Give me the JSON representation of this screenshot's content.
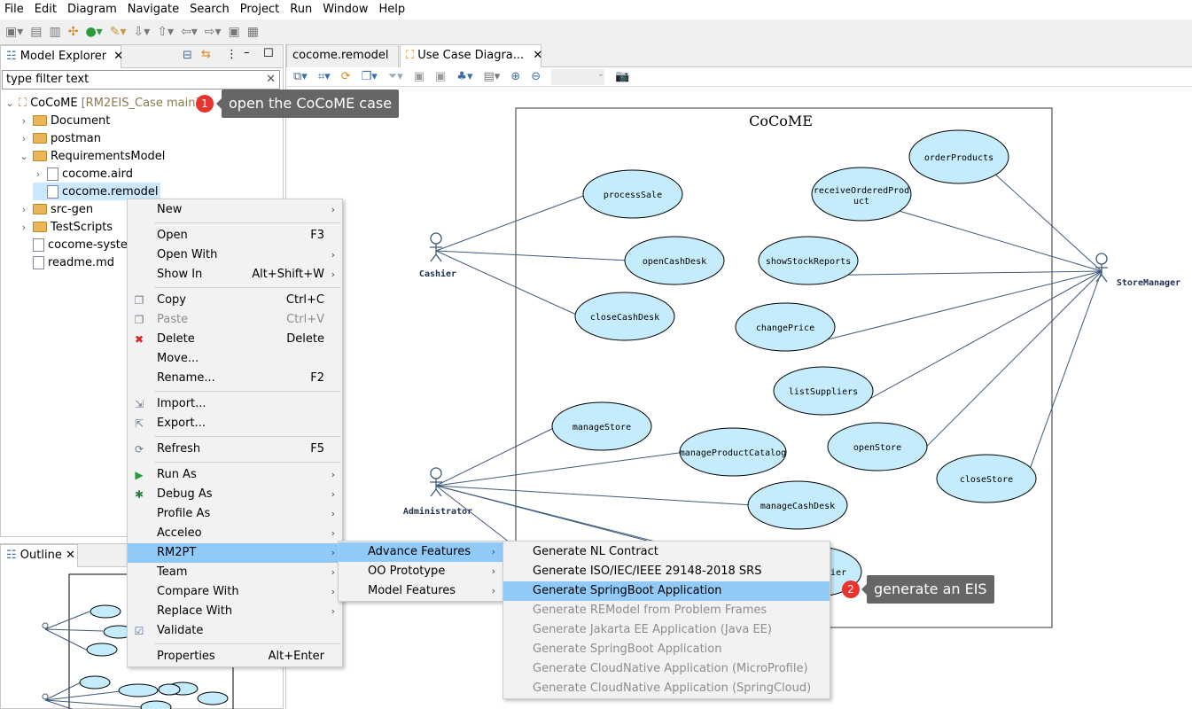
{
  "menubar": [
    "File",
    "Edit",
    "Diagram",
    "Navigate",
    "Search",
    "Project",
    "Run",
    "Window",
    "Help"
  ],
  "explorer": {
    "title": "Model Explorer",
    "filter_placeholder": "type filter text",
    "root": {
      "label": "CoCoME",
      "decoration": "[RM2EIS_Case main]"
    },
    "items": [
      {
        "label": "Document",
        "type": "folder",
        "depth": 1,
        "expanded": false
      },
      {
        "label": "postman",
        "type": "folder",
        "depth": 1,
        "expanded": false
      },
      {
        "label": "RequirementsModel",
        "type": "folder",
        "depth": 1,
        "expanded": true
      },
      {
        "label": "cocome.aird",
        "type": "file",
        "depth": 2,
        "expanded": false
      },
      {
        "label": "cocome.remodel",
        "type": "file",
        "depth": 2,
        "selected": true
      },
      {
        "label": "src-gen",
        "type": "folder",
        "depth": 1,
        "expanded": false
      },
      {
        "label": "TestScripts",
        "type": "folder",
        "depth": 1,
        "expanded": false
      },
      {
        "label": "cocome-system",
        "type": "file",
        "depth": 1
      },
      {
        "label": "readme.md",
        "type": "file",
        "depth": 1
      }
    ]
  },
  "outline": {
    "title": "Outline"
  },
  "editor": {
    "tabs": [
      "cocome.remodel",
      "Use Case Diagra..."
    ],
    "active_tab": 1
  },
  "diagram": {
    "title": "CoCoME",
    "actors": [
      "Cashier",
      "StoreManager",
      "Administrator"
    ],
    "usecases": [
      "orderProducts",
      "processSale",
      "receiveOrderedProduct",
      "openCashDesk",
      "showStockReports",
      "closeCashDesk",
      "changePrice",
      "listSuppliers",
      "manageStore",
      "manageProductCatalog",
      "openStore",
      "closeStore",
      "manageCashDesk",
      "...ier"
    ],
    "colors": {
      "usecase_fill": "#c5ecfd",
      "line": "#3f5a7a"
    }
  },
  "context_menu": [
    {
      "label": "New",
      "sub": true
    },
    {
      "sep": true
    },
    {
      "label": "Open",
      "shortcut": "F3"
    },
    {
      "label": "Open With",
      "sub": true
    },
    {
      "label": "Show In",
      "shortcut": "Alt+Shift+W",
      "sub": true
    },
    {
      "sep": true
    },
    {
      "label": "Copy",
      "shortcut": "Ctrl+C",
      "icon": "copy-icon"
    },
    {
      "label": "Paste",
      "shortcut": "Ctrl+V",
      "disabled": true,
      "icon": "paste-icon"
    },
    {
      "label": "Delete",
      "shortcut": "Delete",
      "icon": "delete-icon"
    },
    {
      "label": "Move..."
    },
    {
      "label": "Rename...",
      "shortcut": "F2"
    },
    {
      "sep": true
    },
    {
      "label": "Import...",
      "icon": "import-icon"
    },
    {
      "label": "Export...",
      "icon": "export-icon"
    },
    {
      "sep": true
    },
    {
      "label": "Refresh",
      "shortcut": "F5",
      "icon": "refresh-icon"
    },
    {
      "sep": true
    },
    {
      "label": "Run As",
      "sub": true,
      "icon": "run-icon"
    },
    {
      "label": "Debug As",
      "sub": true,
      "icon": "debug-icon"
    },
    {
      "label": "Profile As",
      "sub": true
    },
    {
      "label": "Acceleo",
      "sub": true
    },
    {
      "label": "RM2PT",
      "sub": true,
      "selected": true
    },
    {
      "label": "Team",
      "sub": true
    },
    {
      "label": "Compare With",
      "sub": true
    },
    {
      "label": "Replace With",
      "sub": true
    },
    {
      "label": "Validate",
      "icon": "check-icon"
    },
    {
      "sep": true
    },
    {
      "label": "Properties",
      "shortcut": "Alt+Enter"
    }
  ],
  "rm2pt_menu": [
    {
      "label": "Advance Features",
      "sub": true,
      "selected": true
    },
    {
      "label": "OO Prototype",
      "sub": true
    },
    {
      "label": "Model Features",
      "sub": true
    }
  ],
  "advance_menu": [
    {
      "label": "Generate NL Contract"
    },
    {
      "label": "Generate ISO/IEC/IEEE 29148-2018 SRS"
    },
    {
      "label": "Generate SpringBoot Application",
      "selected": true
    },
    {
      "label": "Generate REModel from Problem Frames",
      "disabled": true
    },
    {
      "label": "Generate Jakarta EE Application (Java EE)",
      "disabled": true
    },
    {
      "label": "Generate SpringBoot Application",
      "disabled": true
    },
    {
      "label": "Generate CloudNative Application (MicroProfile)",
      "disabled": true
    },
    {
      "label": "Generate CloudNative Application (SpringCloud)",
      "disabled": true
    }
  ],
  "callouts": [
    {
      "num": "1",
      "text": "open the CoCoME case"
    },
    {
      "num": "2",
      "text": "generate an EIS"
    }
  ]
}
